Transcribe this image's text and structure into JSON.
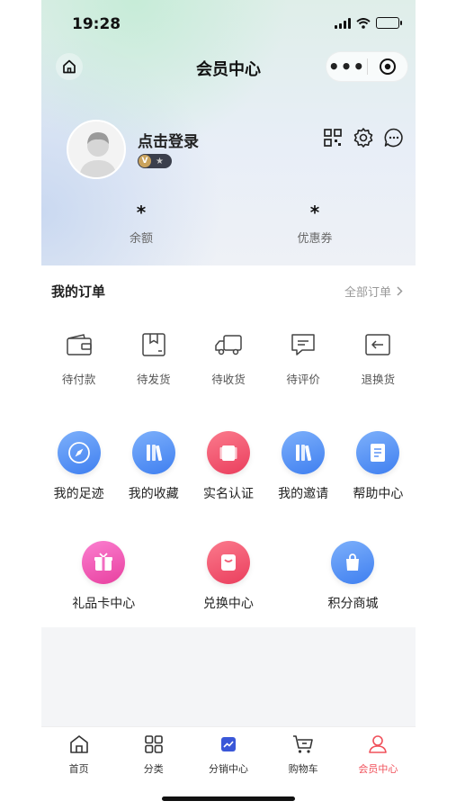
{
  "status_bar": {
    "time": "19:28"
  },
  "nav": {
    "title": "会员中心",
    "home_icon": "home-icon",
    "more_icon": "more-dots-icon",
    "close_icon": "target-icon"
  },
  "profile": {
    "login_label": "点击登录",
    "avatar_icon": "default-avatar",
    "level_badge_star": "★"
  },
  "stats": [
    {
      "value": "*",
      "label": "余额"
    },
    {
      "value": "*",
      "label": "优惠券"
    }
  ],
  "orders": {
    "title": "我的订单",
    "all_label": "全部订单",
    "items": [
      {
        "label": "待付款",
        "icon": "wallet-icon"
      },
      {
        "label": "待发货",
        "icon": "package-icon"
      },
      {
        "label": "待收货",
        "icon": "truck-icon"
      },
      {
        "label": "待评价",
        "icon": "comment-icon"
      },
      {
        "label": "退换货",
        "icon": "return-icon"
      }
    ]
  },
  "services_row1": [
    {
      "label": "我的足迹",
      "icon": "compass-icon",
      "color": "#4d8cf5"
    },
    {
      "label": "我的收藏",
      "icon": "books-icon",
      "color": "#4d8cf5"
    },
    {
      "label": "实名认证",
      "icon": "id-card-icon",
      "color": "#f2506b"
    },
    {
      "label": "我的邀请",
      "icon": "books-icon",
      "color": "#4d8cf5"
    },
    {
      "label": "帮助中心",
      "icon": "document-icon",
      "color": "#4d8cf5"
    }
  ],
  "services_row2": [
    {
      "label": "礼品卡中心",
      "icon": "gift-icon",
      "color": "#f04fb2"
    },
    {
      "label": "兑换中心",
      "icon": "exchange-icon",
      "color": "#f2506b"
    },
    {
      "label": "积分商城",
      "icon": "shopping-bag-icon",
      "color": "#4d8cf5"
    }
  ],
  "tabs": [
    {
      "label": "首页",
      "icon": "home-tab-icon",
      "active": false
    },
    {
      "label": "分类",
      "icon": "grid-icon",
      "active": false
    },
    {
      "label": "分销中心",
      "icon": "chart-icon",
      "active": false
    },
    {
      "label": "购物车",
      "icon": "cart-icon",
      "active": false
    },
    {
      "label": "会员中心",
      "icon": "user-icon",
      "active": true
    }
  ],
  "colors": {
    "accent": "#f0505a",
    "blue": "#4d8cf5",
    "pink": "#f2506b"
  }
}
